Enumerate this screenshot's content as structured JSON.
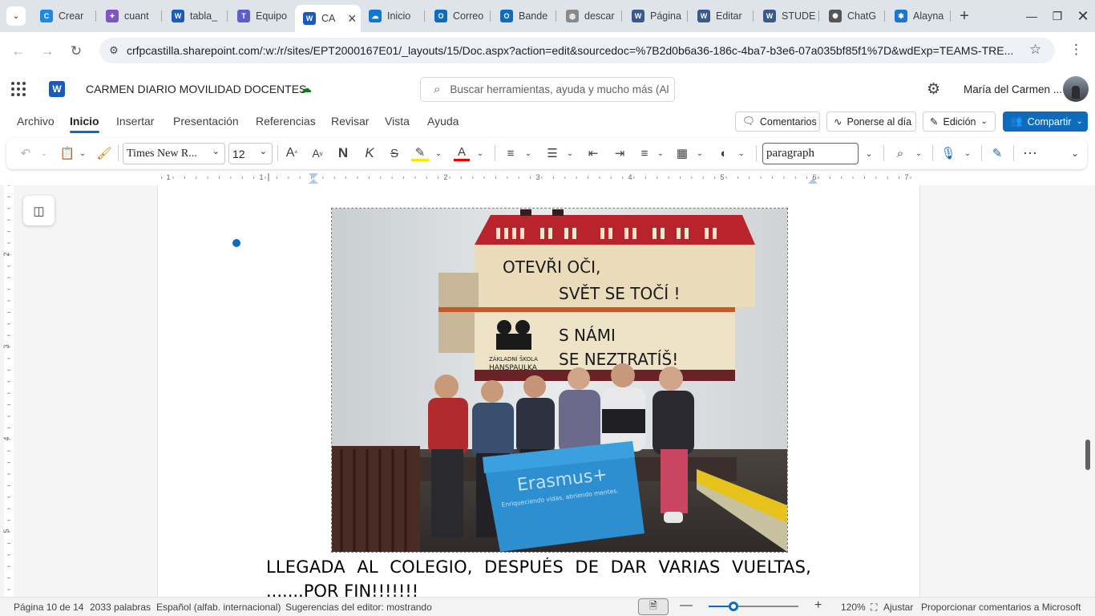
{
  "browser": {
    "tabs": [
      {
        "label": "Crear",
        "color": "#1e88e5",
        "glyph": "C"
      },
      {
        "label": "cuant",
        "color": "#7e57c2",
        "glyph": "✦"
      },
      {
        "label": "tabla_",
        "color": "#185abd",
        "glyph": "W"
      },
      {
        "label": "Equipo",
        "color": "#5b5fc7",
        "glyph": "T"
      },
      {
        "label": "CA",
        "color": "#185abd",
        "glyph": "W"
      },
      {
        "label": "Inicio",
        "color": "#0f78d4",
        "glyph": "☁"
      },
      {
        "label": "Correo",
        "color": "#0f6cbd",
        "glyph": "O"
      },
      {
        "label": "Bande",
        "color": "#0f6cbd",
        "glyph": "O"
      },
      {
        "label": "descar",
        "color": "#8a8a8a",
        "glyph": "◍"
      },
      {
        "label": "Página",
        "color": "#3a5a8c",
        "glyph": "W"
      },
      {
        "label": "Editar",
        "color": "#3a5a8c",
        "glyph": "W"
      },
      {
        "label": "STUDE",
        "color": "#3a5a8c",
        "glyph": "W"
      },
      {
        "label": "ChatG",
        "color": "#555555",
        "glyph": "✺"
      },
      {
        "label": "Alayna",
        "color": "#1976d2",
        "glyph": "✱"
      }
    ],
    "close_tab": "×",
    "new_tab": "+",
    "url": "crfpcastilla.sharepoint.com/:w:/r/sites/EPT2000167E01/_layouts/15/Doc.aspx?action=edit&sourcedoc=%7B2d0b6a36-186c-4ba7-b3e6-07a035bf85f1%7D&wdExp=TEAMS-TRE..."
  },
  "app": {
    "doc_title": "CARMEN DIARIO MOVILIDAD DOCENTES",
    "search_placeholder": "Buscar herramientas, ayuda y mucho más (Al",
    "user_name": "María del Carmen ...",
    "brand_color": "#185abd"
  },
  "menu": {
    "items": [
      "Archivo",
      "Inicio",
      "Insertar",
      "Presentación",
      "Referencias",
      "Revisar",
      "Vista",
      "Ayuda"
    ],
    "selected": "Inicio",
    "comments": "Comentarios",
    "catch_up": "Ponerse al día",
    "editing": "Edición",
    "share": "Compartir"
  },
  "ribbon": {
    "font_name": "Times New R...",
    "font_size": "12",
    "style": "paragraph",
    "bold_label": "N",
    "italic_label": "K",
    "strike_label": "S"
  },
  "ruler": {
    "numbers": [
      "1",
      "1",
      "2",
      "3",
      "4",
      "5",
      "6",
      "7"
    ],
    "left_numbers": [
      "2",
      "3",
      "4",
      "5"
    ]
  },
  "document": {
    "caption_line1": "LLEGADA AL COLEGIO, DESPUÉS DE DAR VARIAS VUELTAS,",
    "caption_line2": ".......POR FIN!!!!!!!",
    "photo": {
      "sign_line1": "OTEVŘI OČI,",
      "sign_line2": "SVĚT SE TOČÍ !",
      "sign_line3": "S NÁMI",
      "sign_line4": "SE NEZTRATÍŠ!",
      "school_line1": "ZÁKLADNÍ ŠKOLA",
      "school_line2": "HANSPAULKA",
      "flag_title": "Erasmus+",
      "flag_sub": "Enriqueciendo vidas, abriendo mentes."
    }
  },
  "status": {
    "page": "Página 10 de 14",
    "words": "2033 palabras",
    "language": "Español (alfab. internacional)",
    "suggestions": "Sugerencias del editor: mostrando",
    "zoom": "120%",
    "fit": "Ajustar",
    "feedback": "Proporcionar comentarios a Microsoft",
    "zoom_level": 0.28
  }
}
